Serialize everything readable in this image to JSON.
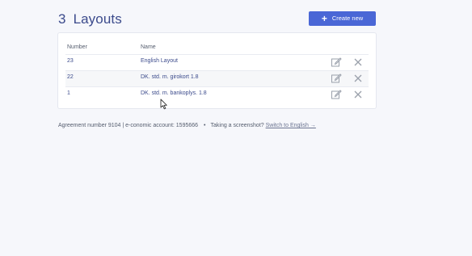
{
  "header": {
    "count": "3",
    "title": "Layouts",
    "create_button": "Create new"
  },
  "table": {
    "columns": {
      "number": "Number",
      "name": "Name"
    },
    "rows": [
      {
        "number": "23",
        "name": "English Layout"
      },
      {
        "number": "22",
        "name": "DK. std. m. girokort 1.8"
      },
      {
        "number": "1",
        "name": "DK. std. m. bankoplys. 1.8"
      }
    ]
  },
  "footer": {
    "agreement": "Agreement number 9104 | e-conomic account: 1595666",
    "separator": "•",
    "screenshot_prompt": "Taking a screenshot?",
    "switch_link": "Switch to English →"
  },
  "colors": {
    "accent": "#4a67d6",
    "title": "#3c4b8c",
    "link": "#3c4b8c"
  }
}
